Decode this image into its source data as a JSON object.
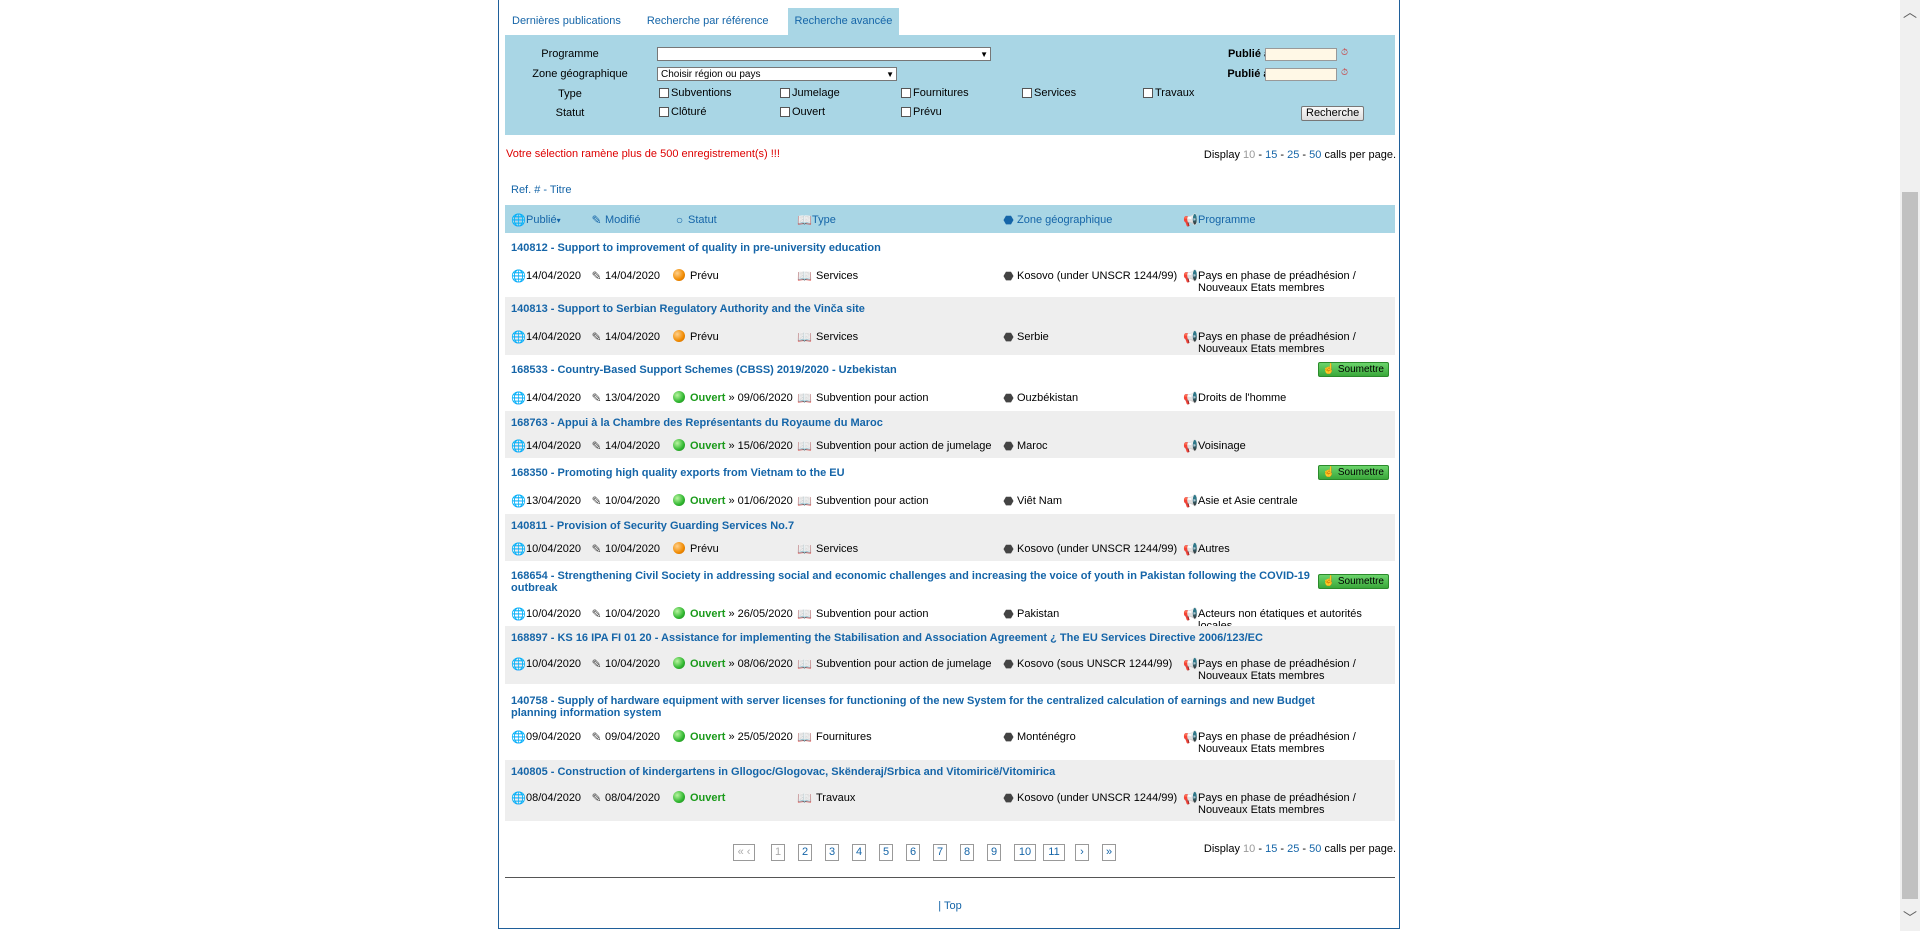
{
  "tabs": [
    "Dernières publications",
    "Recherche par référence",
    "Recherche avancée"
  ],
  "search": {
    "programme_label": "Programme",
    "programme_value": "",
    "zone_label": "Zone géographique",
    "zone_value": "Choisir région ou pays",
    "type_label": "Type",
    "types": [
      "Subventions",
      "Jumelage",
      "Fournitures",
      "Services",
      "Travaux"
    ],
    "statut_label": "Statut",
    "statuts": [
      "Clôturé",
      "Ouvert",
      "Prévu"
    ],
    "publie_avant": "Publié avant le",
    "publie_apres": "Publié après le",
    "button": "Recherche"
  },
  "warning": "Votre sélection ramène plus de 500 enregistrement(s) !!!",
  "display": {
    "prefix": "Display",
    "opts": [
      "10",
      "15",
      "25",
      "50"
    ],
    "suffix": "calls per page."
  },
  "ref_title": "Ref. # - Titre",
  "columns": {
    "publie": "Publié",
    "modifie": "Modifié",
    "statut": "Statut",
    "type": "Type",
    "zone": "Zone géographique",
    "programme": "Programme"
  },
  "submit_label": "Soumettre",
  "rows": [
    {
      "title": "140812 - Support to improvement of quality in pre-university education",
      "pub": "14/04/2020",
      "mod": "14/04/2020",
      "status": "Prévu",
      "deadline": "",
      "type": "Services",
      "zone": "Kosovo (under UNSCR 1244/99)",
      "prog": "Pays en phase de préadhésion / Nouveaux Etats membres"
    },
    {
      "title": "140813 - Support to Serbian Regulatory Authority and the Vinča site",
      "pub": "14/04/2020",
      "mod": "14/04/2020",
      "status": "Prévu",
      "deadline": "",
      "type": "Services",
      "zone": "Serbie",
      "prog": "Pays en phase de préadhésion / Nouveaux Etats membres"
    },
    {
      "title": "168533 - Country-Based Support Schemes (CBSS) 2019/2020 - Uzbekistan",
      "pub": "14/04/2020",
      "mod": "13/04/2020",
      "status": "Ouvert",
      "deadline": "» 09/06/2020",
      "type": "Subvention pour action",
      "zone": "Ouzbékistan",
      "prog": "Droits de l'homme"
    },
    {
      "title": "168763 - Appui à la Chambre des Représentants du Royaume du Maroc",
      "pub": "14/04/2020",
      "mod": "14/04/2020",
      "status": "Ouvert",
      "deadline": "» 15/06/2020",
      "type": "Subvention pour action de jumelage",
      "zone": "Maroc",
      "prog": "Voisinage"
    },
    {
      "title": "168350 - Promoting high quality exports from Vietnam to the EU",
      "pub": "13/04/2020",
      "mod": "10/04/2020",
      "status": "Ouvert",
      "deadline": "» 01/06/2020",
      "type": "Subvention pour action",
      "zone": "Viêt Nam",
      "prog": "Asie et Asie centrale"
    },
    {
      "title": "140811 - Provision of Security Guarding Services No.7",
      "pub": "10/04/2020",
      "mod": "10/04/2020",
      "status": "Prévu",
      "deadline": "",
      "type": "Services",
      "zone": "Kosovo (under UNSCR 1244/99)",
      "prog": "Autres"
    },
    {
      "title": "168654 - Strengthening Civil Society in addressing social and economic challenges and increasing the voice of youth in Pakistan following the COVID-19 outbreak",
      "pub": "10/04/2020",
      "mod": "10/04/2020",
      "status": "Ouvert",
      "deadline": "» 26/05/2020",
      "type": "Subvention pour action",
      "zone": "Pakistan",
      "prog": "Acteurs non étatiques et autorités locales"
    },
    {
      "title": "168897 - KS 16 IPA FI 01 20 - Assistance for implementing the Stabilisation and Association Agreement ¿ The EU Services Directive 2006/123/EC",
      "pub": "10/04/2020",
      "mod": "10/04/2020",
      "status": "Ouvert",
      "deadline": "» 08/06/2020",
      "type": "Subvention pour action de jumelage",
      "zone": "Kosovo (sous UNSCR 1244/99)",
      "prog": "Pays en phase de préadhésion / Nouveaux Etats membres"
    },
    {
      "title": "140758 - Supply of hardware equipment with server licenses for functioning of the new System for the centralized calculation of earnings and new Budget planning information system",
      "pub": "09/04/2020",
      "mod": "09/04/2020",
      "status": "Ouvert",
      "deadline": "» 25/05/2020",
      "type": "Fournitures",
      "zone": "Monténégro",
      "prog": "Pays en phase de préadhésion / Nouveaux Etats membres"
    },
    {
      "title": "140805 - Construction of kindergartens in Gllogoc/Glogovac, Skënderaj/Srbica and Vitomiricë/Vitomirica",
      "pub": "08/04/2020",
      "mod": "08/04/2020",
      "status": "Ouvert",
      "deadline": "",
      "type": "Travaux",
      "zone": "Kosovo (under UNSCR 1244/99)",
      "prog": "Pays en phase de préadhésion / Nouveaux Etats membres"
    }
  ],
  "pager": {
    "first": "«",
    "prev": "‹",
    "pages": [
      "1",
      "2",
      "3",
      "4",
      "5",
      "6",
      "7",
      "8",
      "9",
      "10",
      "11"
    ],
    "next": "›",
    "last": "»"
  },
  "footer": {
    "sep": "|",
    "top": "Top"
  }
}
